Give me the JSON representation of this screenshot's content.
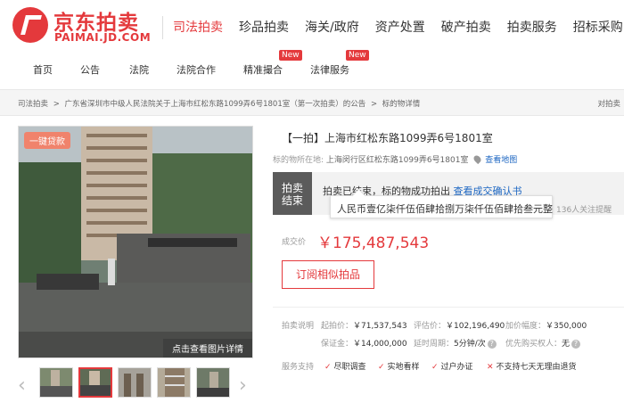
{
  "header": {
    "logo_cn": "京东拍卖",
    "logo_en": "PAIMAI.JD.COM",
    "nav": [
      "司法拍卖",
      "珍品拍卖",
      "海关/政府",
      "资产处置",
      "破产拍卖",
      "拍卖服务",
      "招标采购"
    ]
  },
  "subnav": {
    "items": [
      "首页",
      "公告",
      "法院",
      "法院合作",
      "精准撮合",
      "法律服务"
    ],
    "new_tag": "New"
  },
  "breadcrumb": {
    "items": [
      "司法拍卖",
      "广东省深圳市中级人民法院关于上海市红松东路1099弄6号1801室（第一次拍卖）的公告",
      "标的物详情"
    ],
    "separator": ">",
    "right": "对拍卖"
  },
  "gallery": {
    "loan_tag": "一键贷款",
    "detail_link": "点击查看图片详情",
    "prev": "‹",
    "next": "›"
  },
  "lot": {
    "title": "【一拍】上海市红松东路1099弄6号1801室",
    "location_label": "标的物所在地:",
    "location": "上海闵行区红松东路1099弄6号1801室",
    "map_link": "查看地图",
    "status_label_1": "拍卖",
    "status_label_2": "结束",
    "status_text": "拍卖已结束，标的物成功拍出",
    "confirm_link": "查看成交确认书",
    "watchers": "136人关注提醒",
    "tooltip": "人民币壹亿柒仟伍佰肆拾捌万柒仟伍佰肆拾叁元整",
    "price_label": "成交价",
    "price": "￥175,487,543",
    "subscribe_button": "订阅相似拍品"
  },
  "auction_info": {
    "section_label": "拍卖说明",
    "row1": [
      {
        "k": "起拍价：",
        "v": "￥71,537,543"
      },
      {
        "k": "评估价：",
        "v": "￥102,196,490"
      },
      {
        "k": "加价幅度：",
        "v": "￥350,000"
      }
    ],
    "row2": [
      {
        "k": "保证金：",
        "v": "￥14,000,000"
      },
      {
        "k": "延时周期：",
        "v": "5分钟/次"
      },
      {
        "k": "优先购买权人：",
        "v": "无"
      }
    ],
    "help": "?"
  },
  "services": {
    "label": "服务支持",
    "items": [
      "尽职调查",
      "实地看样",
      "过户办证"
    ],
    "no_return": "不支持七天无理由退货"
  },
  "colors": {
    "brand": "#e4393c",
    "link": "#1c66c2"
  }
}
